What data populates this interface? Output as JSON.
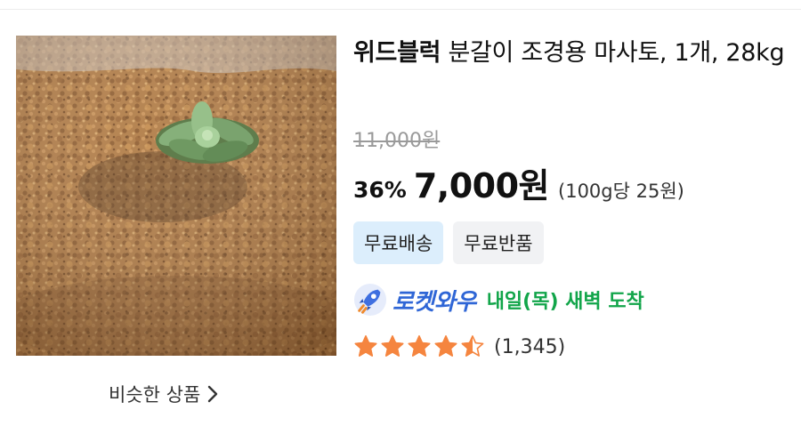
{
  "product": {
    "title_brand": "위드블럭",
    "title_rest": " 분갈이 조경용 마사토, 1개, 28kg",
    "original_price": "11,000원",
    "discount_rate": "36%",
    "sale_price": "7,000원",
    "unit_price": "(100g당 25원)",
    "rating_value": 4.5,
    "rating_max": 5,
    "review_count": "(1,345)"
  },
  "badges": {
    "free_shipping": "무료배송",
    "free_return": "무료반품"
  },
  "delivery": {
    "program": "로켓와우",
    "eta": "내일(목) 새벽 도착"
  },
  "links": {
    "similar_products": "비슷한 상품"
  },
  "icons": {
    "delivery": "rocket-icon",
    "rating": "star-icon",
    "similar": "chevron-right-icon",
    "image": "succulent-soil-photo"
  },
  "colors": {
    "star": "#f5853f",
    "rocket_text": "#2f66d6",
    "delivery_text": "#12a54a",
    "badge_ship_bg": "#dceefc",
    "badge_return_bg": "#f1f2f4",
    "original_price": "#9a9a9a"
  }
}
